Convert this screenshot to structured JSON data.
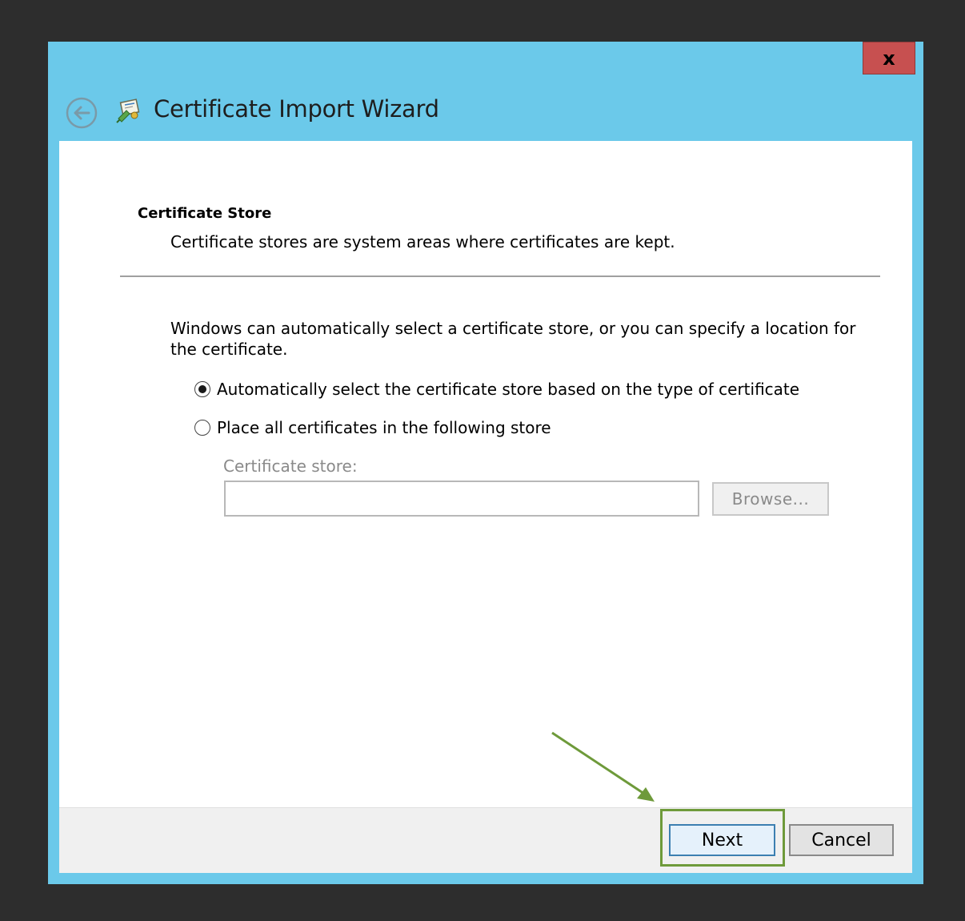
{
  "window": {
    "title": "Certificate Import Wizard",
    "close_label": "x",
    "back_icon": "back-arrow-icon",
    "title_icon": "certificate-wizard-icon"
  },
  "page": {
    "section_title": "Certificate Store",
    "section_subtitle": "Certificate stores are system areas where certificates are kept.",
    "description": "Windows can automatically select a certificate store, or you can specify a location for the certificate.",
    "options": [
      {
        "label": "Automatically select the certificate store based on the type of certificate",
        "selected": true
      },
      {
        "label": "Place all certificates in the following store",
        "selected": false
      }
    ],
    "store_label": "Certificate store:",
    "store_value": "",
    "browse_label": "Browse..."
  },
  "footer": {
    "next_label": "Next",
    "cancel_label": "Cancel"
  },
  "annotation": {
    "highlight_color": "#6e9a3a",
    "arrow_color": "#6e9a3a"
  },
  "colors": {
    "frame": "#6bc9ea",
    "close": "#c75050",
    "background": "#2d2d2d"
  }
}
